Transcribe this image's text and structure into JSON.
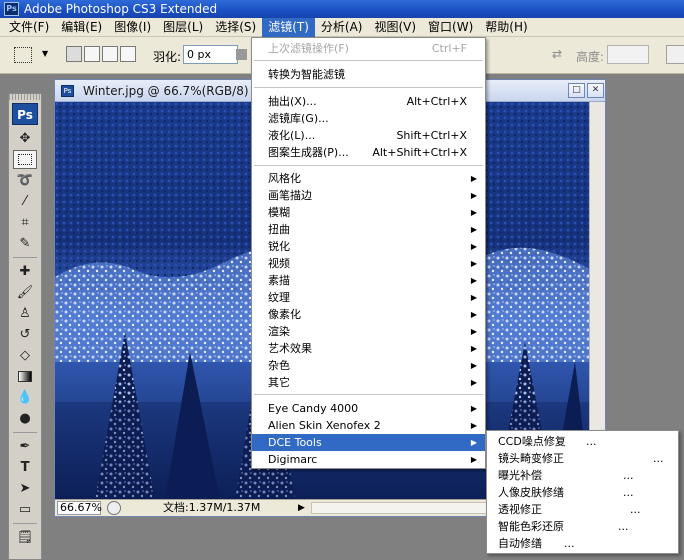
{
  "app": {
    "title": "Adobe Photoshop CS3 Extended"
  },
  "menubar": {
    "items": [
      {
        "label": "文件(F)"
      },
      {
        "label": "编辑(E)"
      },
      {
        "label": "图像(I)"
      },
      {
        "label": "图层(L)"
      },
      {
        "label": "选择(S)"
      },
      {
        "label": "滤镜(T)",
        "active": true
      },
      {
        "label": "分析(A)"
      },
      {
        "label": "视图(V)"
      },
      {
        "label": "窗口(W)"
      },
      {
        "label": "帮助(H)"
      }
    ]
  },
  "options": {
    "feather_label": "羽化:",
    "feather_value": "0 px",
    "height_label": "高度:"
  },
  "toolbox": {
    "logo": "Ps"
  },
  "document": {
    "title": "Winter.jpg @ 66.7%(RGB/8)",
    "zoom": "66.67%",
    "doc_size": "文档:1.37M/1.37M"
  },
  "filter_menu": {
    "last_filter": {
      "label": "上次滤镜操作(F)",
      "shortcut": "Ctrl+F",
      "disabled": true
    },
    "convert_smart": {
      "label": "转换为智能滤镜"
    },
    "group1": [
      {
        "label": "抽出(X)...",
        "shortcut": "Alt+Ctrl+X"
      },
      {
        "label": "滤镜库(G)..."
      },
      {
        "label": "液化(L)...",
        "shortcut": "Shift+Ctrl+X"
      },
      {
        "label": "图案生成器(P)...",
        "shortcut": "Alt+Shift+Ctrl+X"
      }
    ],
    "categories": [
      "风格化",
      "画笔描边",
      "模糊",
      "扭曲",
      "锐化",
      "视频",
      "素描",
      "纹理",
      "像素化",
      "渲染",
      "艺术效果",
      "杂色",
      "其它"
    ],
    "plugins": [
      {
        "label": "Eye Candy 4000"
      },
      {
        "label": "Alien Skin Xenofex 2"
      },
      {
        "label": "DCE Tools",
        "highlighted": true
      },
      {
        "label": "Digimarc"
      }
    ]
  },
  "submenu": {
    "items": [
      "CCD噪点修复",
      "镜头畸变修正",
      "曝光补偿",
      "人像皮肤修缮",
      "透视修正",
      "智能色彩还原",
      "自动修缮"
    ],
    "dots": "..."
  }
}
